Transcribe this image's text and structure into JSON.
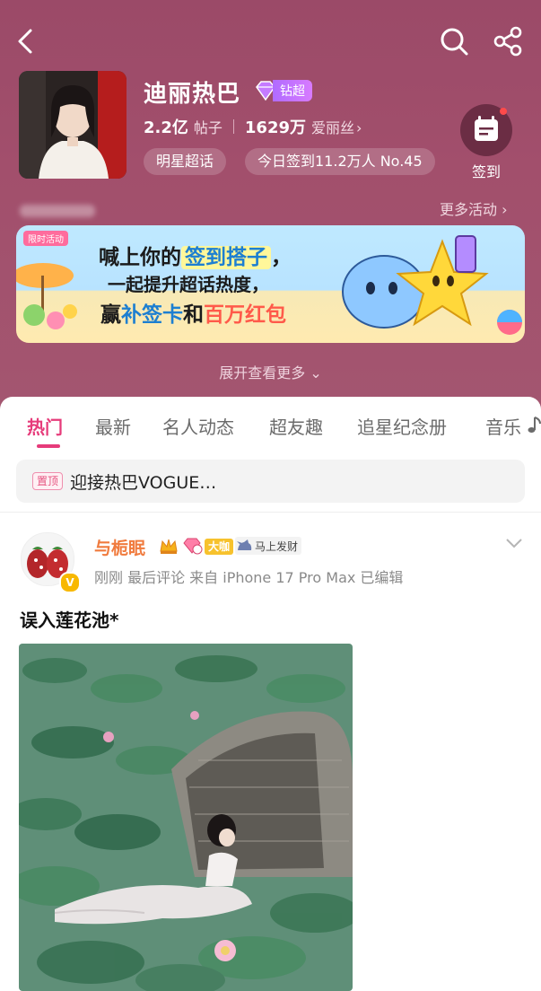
{
  "topbar": {
    "back_icon": "back-icon",
    "search_icon": "search-icon",
    "share_icon": "share-icon"
  },
  "profile": {
    "title": "迪丽热巴",
    "badge_label": "钻超",
    "posts_count": "2.2亿",
    "posts_unit": "帖子",
    "fans_count": "1629万",
    "fans_unit": "爱丽丝",
    "tag_label": "明星超话",
    "checkin_stats": "今日签到11.2万人 No.45",
    "checkin_label": "签到"
  },
  "activity": {
    "more_label": "更多活动 ›"
  },
  "banner": {
    "tag": "限时活动",
    "line1_a": "喊上你的",
    "line1_b": "签到搭子",
    "line1_c": "，",
    "line2": "一起提升超话热度，",
    "line3_a": "赢",
    "line3_b": "补签卡",
    "line3_c": "和",
    "line3_d": "百万红包"
  },
  "expand_label": "展开查看更多",
  "tabs": [
    {
      "label": "热门"
    },
    {
      "label": "最新"
    },
    {
      "label": "名人动态"
    },
    {
      "label": "超友趣"
    },
    {
      "label": "追星纪念册"
    },
    {
      "label": "音乐"
    }
  ],
  "pinned": {
    "badge": "置顶",
    "text": "迎接热巴VOGUE…"
  },
  "post": {
    "username": "与栀眠",
    "level_badge": "大咖",
    "fortune_badge": "马上发财",
    "meta": "刚刚  最后评论  来自 iPhone 17 Pro Max  已编辑",
    "text": "误入莲花池*"
  },
  "colors": {
    "header_bg": "#a24f6c",
    "accent": "#e63b7a",
    "username": "#f07b3e"
  }
}
